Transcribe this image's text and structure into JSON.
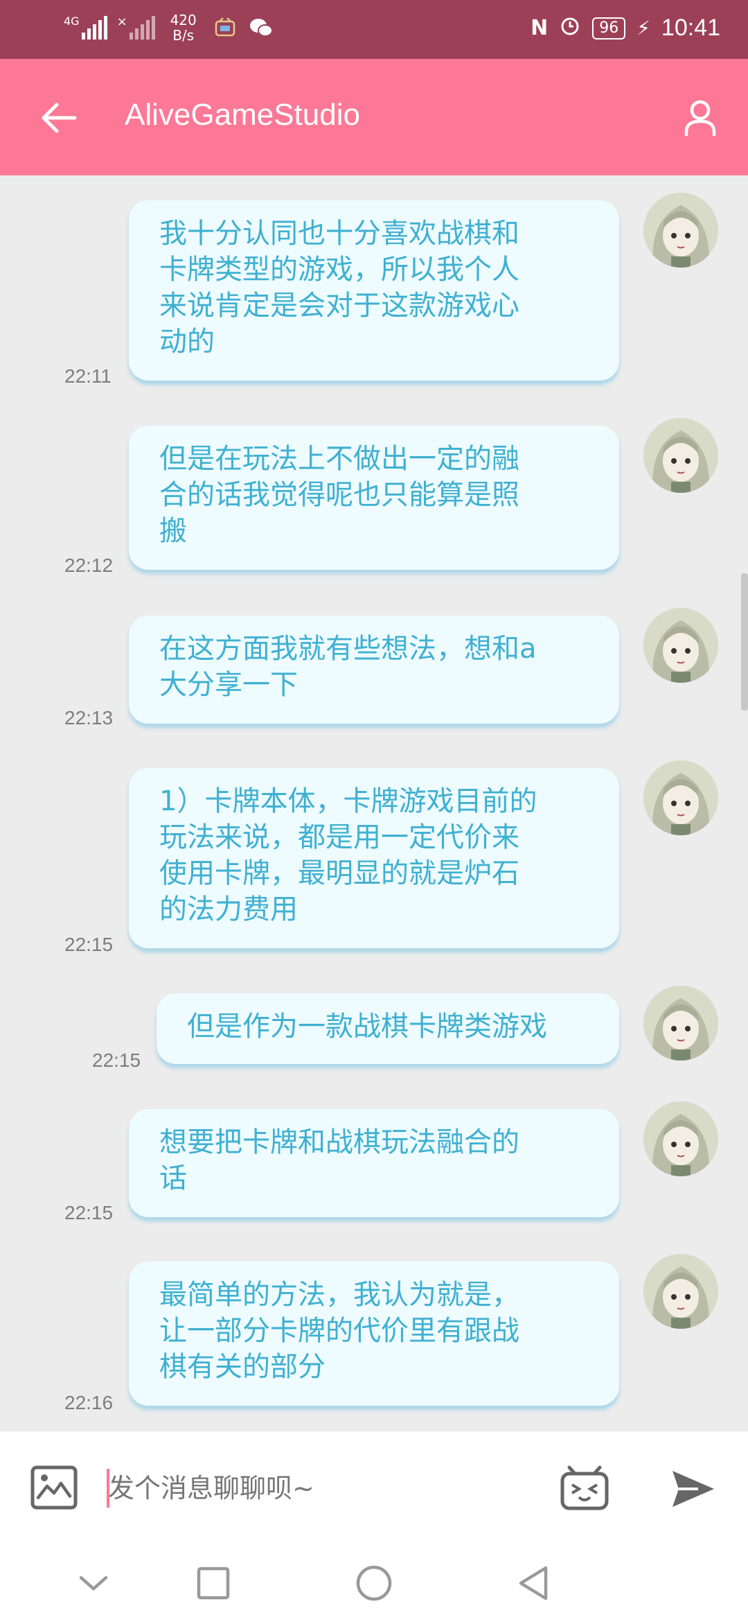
{
  "status_bar": {
    "signal1_label": "4G",
    "network_speed_value": "420",
    "network_speed_unit": "B/s",
    "battery": "96",
    "time": "10:41"
  },
  "app_bar": {
    "title": "AliveGameStudio"
  },
  "messages": [
    {
      "text": "我十分认同也十分喜欢战棋和\n卡牌类型的游戏，所以我个人\n来说肯定是会对于这款游戏心\n动的",
      "time": "22:11"
    },
    {
      "text": "但是在玩法上不做出一定的融\n合的话我觉得呢也只能算是照\n搬",
      "time": "22:12"
    },
    {
      "text": "在这方面我就有些想法，想和a\n大分享一下",
      "time": "22:13"
    },
    {
      "text": "1）卡牌本体，卡牌游戏目前的\n玩法来说，都是用一定代价来\n使用卡牌，最明显的就是炉石\n的法力费用",
      "time": "22:15"
    },
    {
      "text": "但是作为一款战棋卡牌类游戏",
      "time": "22:15"
    },
    {
      "text": "想要把卡牌和战棋玩法融合的\n话",
      "time": "22:15"
    },
    {
      "text": "最简单的方法，我认为就是，\n让一部分卡牌的代价里有跟战\n棋有关的部分",
      "time": "22:16"
    }
  ],
  "input_bar": {
    "placeholder": "发个消息聊聊呗~"
  },
  "colors": {
    "status_bar": "#9c4058",
    "app_bar": "#fd7896",
    "bubble_bg": "#eefbff",
    "bubble_text": "#3fb0d1",
    "chat_bg": "#ececec"
  }
}
